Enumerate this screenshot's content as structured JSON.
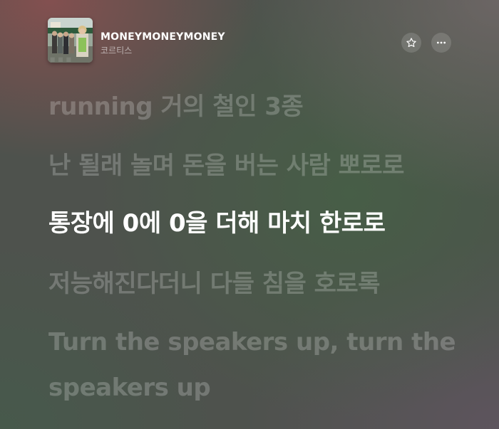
{
  "header": {
    "song_title": "MONEYMONEYMONEY",
    "artist": "코르티스",
    "favorite_icon": "star-icon",
    "more_icon": "ellipsis-icon"
  },
  "lyrics": {
    "partial_line": "…",
    "lines": [
      "running 거의 철인 3종",
      "난 될래 놀며 돈을 버는 사람 뽀로로",
      "통장에 0에 0을 더해 마치 한로로",
      "저능해진다더니 다들 침을 호로록",
      "Turn the speakers up, turn the",
      "speakers up"
    ],
    "active_index": 2
  },
  "colors": {
    "active_lyric": "#ffffff",
    "inactive_lyric": "rgba(255,255,255,0.22)"
  }
}
